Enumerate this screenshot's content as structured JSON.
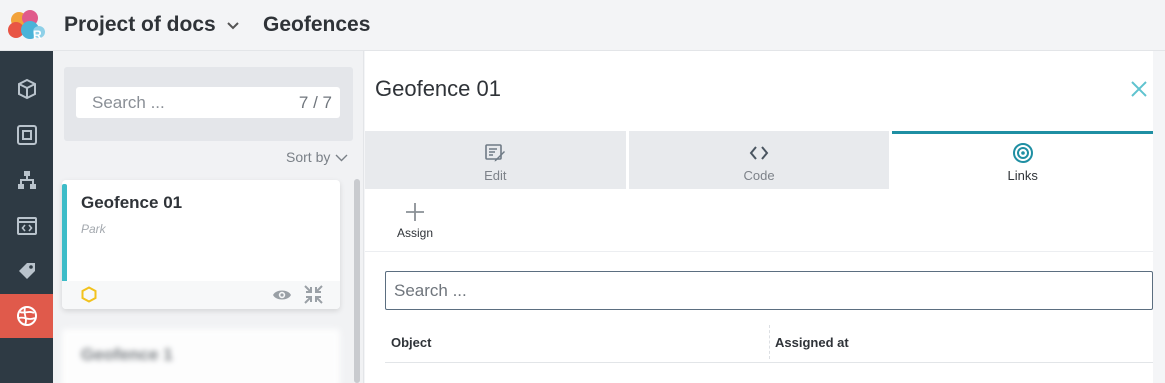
{
  "header": {
    "project_name": "Project of docs",
    "breadcrumb": "Geofences"
  },
  "sidebar": {
    "items": [
      {
        "icon": "cube-icon",
        "active": false
      },
      {
        "icon": "device-icon",
        "active": false
      },
      {
        "icon": "hierarchy-icon",
        "active": false
      },
      {
        "icon": "code-window-icon",
        "active": false
      },
      {
        "icon": "tag-icon",
        "active": false
      },
      {
        "icon": "globe-icon",
        "active": true
      }
    ],
    "active_color": "#e05a4b"
  },
  "list": {
    "search_placeholder": "Search ...",
    "count": "7 / 7",
    "sort_label": "Sort by",
    "items": [
      {
        "name": "Geofence 01",
        "subtitle": "Park",
        "selected": true
      },
      {
        "name": "Geofence 1",
        "subtitle": "",
        "selected": false
      }
    ],
    "accent_color": "#3dbcc8"
  },
  "detail": {
    "title": "Geofence 01",
    "tabs": [
      {
        "label": "Edit",
        "icon": "edit-icon",
        "active": false
      },
      {
        "label": "Code",
        "icon": "code-icon",
        "active": false
      },
      {
        "label": "Links",
        "icon": "target-icon",
        "active": true
      }
    ],
    "assign_label": "Assign",
    "search_placeholder": "Search ...",
    "columns": [
      "Object",
      "Assigned at"
    ],
    "tab_active_color": "#1f8fa3"
  }
}
